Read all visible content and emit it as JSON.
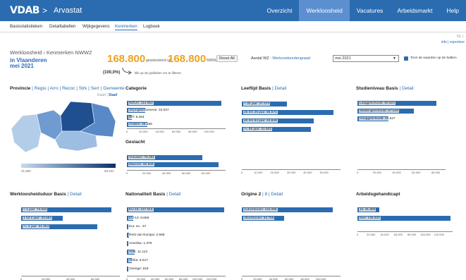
{
  "header": {
    "logo": "VDAB",
    "logo_arrow": ">",
    "app_title": "Arvastat",
    "nav": [
      {
        "label": "Overzicht",
        "active": false
      },
      {
        "label": "Werkloosheid",
        "active": true
      },
      {
        "label": "Vacatures",
        "active": false
      },
      {
        "label": "Arbeidsmarkt",
        "active": false
      },
      {
        "label": "Help",
        "active": false
      }
    ]
  },
  "subnav": {
    "items": [
      {
        "label": "Basisstatistieken",
        "active": false
      },
      {
        "label": "Detailtabellen",
        "active": false
      },
      {
        "label": "Wijkgegevens",
        "active": false
      },
      {
        "label": "Kenmerken",
        "active": true
      },
      {
        "label": "Logboek",
        "active": false
      }
    ],
    "lang": "NL |",
    "info_links": "info | exporteer"
  },
  "summary": {
    "breadcrumb": "Werkloosheid › Kenmerken NWWZ",
    "region": "in Vlaanderen",
    "period": "mei 2021",
    "selected_value": "168.800",
    "selected_suffix": "geselecteerd uit",
    "total_value": "168.800",
    "total_suffix": "NWWZ",
    "percent": "(100,0%)",
    "hint": "klik op de grafieken om te filteren",
    "reset_label": "Reset All",
    "wz_label": "Aantal WZ :",
    "wz_link": "Werkzoekendengraad",
    "month_select": "mei 2021",
    "checkbox_label": "Toon de waarden op de balken",
    "checkbox_checked": true
  },
  "colors": {
    "brand": "#2b6cb0",
    "accent": "#f0a21e",
    "bar": "#2b6cb0"
  },
  "panels": {
    "provincie": {
      "title": "Provincie",
      "links": "| Regio | Arro | Recoc | Strk | Serr | Gemeente",
      "view_kaart": "Kaart",
      "view_staaf": "Staaf",
      "legend_min": "21.800",
      "legend_max": "55.222"
    },
    "categorie": {
      "title": "Categorie"
    },
    "geslacht": {
      "title": "Geslacht"
    },
    "leeftijd": {
      "title": "Leeftijd",
      "basis": "Basis",
      "detail": "| Detail"
    },
    "studieniveau": {
      "title": "Studieniveau",
      "basis": "Basis",
      "detail": "| Detail"
    },
    "werkloosheidsduur": {
      "title": "Werkloosheidsduur",
      "basis": "Basis",
      "detail": "| Detail"
    },
    "nationaliteit": {
      "title": "Nationaliteit",
      "basis": "Basis",
      "detail": "| Detail"
    },
    "origine": {
      "title": "Origine",
      "basis": "2",
      "detail": "| 8 | Detail"
    },
    "arbeidshandicapt": {
      "title": "Arbeidsgehandicapt"
    }
  },
  "chart_data": [
    {
      "id": "categorie",
      "type": "bar",
      "categories": [
        "WZUA",
        "Vrij ingeschrevene",
        "BIT",
        "Andere"
      ],
      "values": [
        114862,
        22037,
        6264,
        25258
      ],
      "value_labels": [
        "114.862",
        "22.037",
        "6.264",
        "25.258"
      ],
      "xlim": [
        0,
        120000
      ],
      "ticks": [
        "0",
        "20.000",
        "40.000",
        "60.000",
        "80.000",
        "100.000"
      ]
    },
    {
      "id": "geslacht",
      "type": "bar",
      "categories": [
        "Vrouwen",
        "Mannen"
      ],
      "values": [
        76291,
        92509
      ],
      "value_labels": [
        "76.291",
        "92.509"
      ],
      "xlim": [
        0,
        100000
      ],
      "ticks": [
        "0",
        "20.000",
        "40.000",
        "60.000",
        "80.000"
      ]
    },
    {
      "id": "leeftijd",
      "type": "bar",
      "categories": [
        "< 25 jaar",
        "25 t/m 39 jaar",
        "40 t/m 54 jaar",
        ">= 55 jaar"
      ],
      "values": [
        27474,
        55574,
        43849,
        41903
      ],
      "value_labels": [
        "27.474",
        "55.574",
        "43.849",
        "41.903"
      ],
      "xlim": [
        0,
        60000
      ],
      "ticks": [
        "0",
        "10.000",
        "20.000",
        "30.000",
        "40.000",
        "50.000"
      ]
    },
    {
      "id": "studieniveau",
      "type": "bar",
      "categories": [
        "Laaggeschoold",
        "Middengeschoold",
        "Hooggeschoold"
      ],
      "values": [
        80624,
        57649,
        31527
      ],
      "value_labels": [
        "80.624",
        "57.649",
        "31.527"
      ],
      "xlim": [
        0,
        90000
      ],
      "ticks": [
        "0",
        "20.000",
        "40.000",
        "60.000",
        "80.000"
      ]
    },
    {
      "id": "werkloosheidsduur",
      "type": "bar",
      "categories": [
        "< 1 jaar",
        "1 tot 2 jaar",
        ">= 2 jaar"
      ],
      "values": [
        73062,
        33684,
        61954
      ],
      "value_labels": [
        "73.062",
        "33.684",
        "61.954"
      ],
      "xlim": [
        0,
        80000
      ],
      "ticks": [
        "0",
        "20.000",
        "40.000",
        "60.000"
      ]
    },
    {
      "id": "nationaliteit",
      "type": "bar",
      "categories": [
        "EU-15",
        "EU-13",
        "Eur. ex.",
        "Rest van Europa",
        "Amerika",
        "Azië",
        "Afrika",
        "Overige"
      ],
      "values": [
        137516,
        8659,
        37,
        2666,
        1379,
        11113,
        6617,
        819
      ],
      "value_labels": [
        "137.516",
        "8.659",
        "37",
        "2.666",
        "1.379",
        "11.113",
        "6.617",
        "819"
      ],
      "xlim": [
        0,
        140000
      ],
      "ticks": [
        "0",
        "20.000",
        "40.000",
        "60.000",
        "80.000",
        "100.000",
        "120.000"
      ]
    },
    {
      "id": "origine",
      "type": "bar",
      "categories": [
        "Autochtonen",
        "Allochtonen"
      ],
      "values": [
        115096,
        53755
      ],
      "value_labels": [
        "115.096",
        "53.755"
      ],
      "xlim": [
        0,
        125000
      ],
      "ticks": [
        "0",
        "20.000",
        "40.000",
        "60.000",
        "80.000",
        "100.000"
      ]
    },
    {
      "id": "arbeidshandicapt",
      "type": "bar",
      "categories": [
        "Ja",
        "Nee"
      ],
      "values": [
        31880,
        136920
      ],
      "value_labels": [
        "31.880",
        "136.920"
      ],
      "xlim": [
        0,
        140000
      ],
      "ticks": [
        "0",
        "20.000",
        "40.000",
        "60.000",
        "80.000",
        "100.000",
        "120.000"
      ]
    }
  ]
}
